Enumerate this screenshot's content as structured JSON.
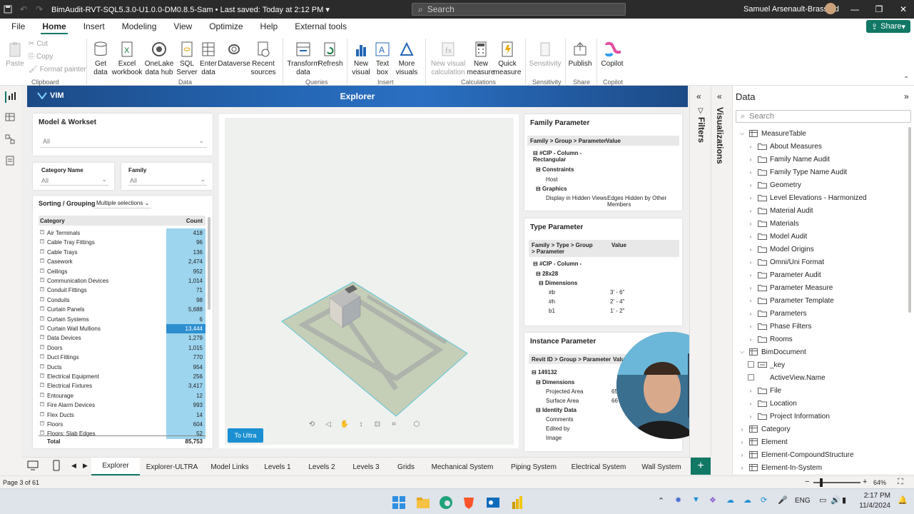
{
  "window": {
    "title": "BimAudit-RVT-SQL5.3.0-U1.0.0-DM0.8.5-Sam",
    "saved": "Last saved: Today at 2:12 PM",
    "search_placeholder": "Search",
    "user": "Samuel Arsenault-Brassard"
  },
  "menu": [
    "File",
    "Home",
    "Insert",
    "Modeling",
    "View",
    "Optimize",
    "Help",
    "External tools"
  ],
  "menu_active": "Home",
  "share_label": "Share",
  "ribbon": {
    "clipboard": {
      "paste": "Paste",
      "cut": "Cut",
      "copy": "Copy",
      "format_painter": "Format painter",
      "label": "Clipboard"
    },
    "data": {
      "get_data": "Get data",
      "excel": "Excel workbook",
      "onelake": "OneLake data hub",
      "sql": "SQL Server",
      "enter": "Enter data",
      "dataverse": "Dataverse",
      "recent": "Recent sources",
      "label": "Data"
    },
    "queries": {
      "transform": "Transform data",
      "refresh": "Refresh",
      "label": "Queries"
    },
    "insert": {
      "new_visual": "New visual",
      "text_box": "Text box",
      "more_visuals": "More visuals",
      "label": "Insert"
    },
    "calculations": {
      "new_visual_calc": "New visual calculation",
      "new_measure": "New measure",
      "quick_measure": "Quick measure",
      "label": "Calculations"
    },
    "sensitivity": {
      "btn": "Sensitivity",
      "label": "Sensitivity"
    },
    "share": {
      "publish": "Publish",
      "label": "Share"
    },
    "copilot": {
      "btn": "Copilot",
      "label": "Copilot"
    }
  },
  "report": {
    "logo": "VIM",
    "title": "Explorer",
    "model_workset": {
      "title": "Model & Workset",
      "value": "All"
    },
    "category_name": {
      "title": "Category Name",
      "value": "All"
    },
    "family": {
      "title": "Family",
      "value": "All"
    },
    "sorting": {
      "title": "Sorting / Grouping",
      "value": "Multiple selections"
    },
    "category_table": {
      "col_category": "Category",
      "col_count": "Count",
      "rows": [
        {
          "name": "Air Terminals",
          "count": "418"
        },
        {
          "name": "Cable Tray Fittings",
          "count": "96"
        },
        {
          "name": "Cable Trays",
          "count": "136"
        },
        {
          "name": "Casework",
          "count": "2,474"
        },
        {
          "name": "Ceilings",
          "count": "952"
        },
        {
          "name": "Communication Devices",
          "count": "1,014"
        },
        {
          "name": "Conduit Fittings",
          "count": "71"
        },
        {
          "name": "Conduits",
          "count": "98"
        },
        {
          "name": "Curtain Panels",
          "count": "5,688"
        },
        {
          "name": "Curtain Systems",
          "count": "6"
        },
        {
          "name": "Curtain Wall Mullions",
          "count": "13,444"
        },
        {
          "name": "Data Devices",
          "count": "1,279"
        },
        {
          "name": "Doors",
          "count": "1,015"
        },
        {
          "name": "Duct Fittings",
          "count": "770"
        },
        {
          "name": "Ducts",
          "count": "954"
        },
        {
          "name": "Electrical Equipment",
          "count": "256"
        },
        {
          "name": "Electrical Fixtures",
          "count": "3,417"
        },
        {
          "name": "Entourage",
          "count": "12"
        },
        {
          "name": "Fire Alarm Devices",
          "count": "993"
        },
        {
          "name": "Flex Ducts",
          "count": "14"
        },
        {
          "name": "Floors",
          "count": "604"
        },
        {
          "name": "Floors: Slab Edges",
          "count": "52"
        }
      ],
      "total_label": "Total",
      "total_value": "85,753",
      "highlight_index": 10
    },
    "to_ultra": "To Ultra",
    "family_param": {
      "title": "Family Parameter",
      "col1": "Family > Group > Parameter",
      "col2": "Value",
      "r1": "#CIP - Column - Rectangular",
      "r2": "Constraints",
      "r3": "Host",
      "r4": "Graphics",
      "r5": "Display in Hidden Views",
      "r5v": "Edges Hidden by Other Members"
    },
    "type_param": {
      "title": "Type Parameter",
      "col1": "Family > Type > Group > Parameter",
      "col2": "Value",
      "r1": "#CIP - Column -",
      "r2": "28x28",
      "r3": "Dimensions",
      "rows": [
        {
          "k": "#b",
          "v": "3' - 6\""
        },
        {
          "k": "#h",
          "v": "2' - 4\""
        },
        {
          "k": "b1",
          "v": "1' - 2\""
        }
      ]
    },
    "instance_param": {
      "title": "Instance Parameter",
      "col1": "Revit ID > Group > Parameter",
      "col2": "Valu",
      "r1": "149132",
      "r2": "Dimensions",
      "r3": "Projected Area",
      "r3v": "65",
      "r4": "Surface Area",
      "r4v": "66",
      "r5": "Identity Data",
      "r6": "Comments",
      "r7": "Edited by",
      "r8": "Image"
    }
  },
  "panes": {
    "filters": "Filters",
    "visualizations": "Visualizations"
  },
  "data_pane": {
    "title": "Data",
    "search": "Search",
    "tree": [
      {
        "label": "MeasureTable",
        "level": 0,
        "type": "table",
        "open": true
      },
      {
        "label": "About Measures",
        "level": 1,
        "type": "folder"
      },
      {
        "label": "Family Name Audit",
        "level": 1,
        "type": "folder"
      },
      {
        "label": "Family Type Name Audit",
        "level": 1,
        "type": "folder"
      },
      {
        "label": "Geometry",
        "level": 1,
        "type": "folder"
      },
      {
        "label": "Level Elevations - Harmonized",
        "level": 1,
        "type": "folder"
      },
      {
        "label": "Material Audit",
        "level": 1,
        "type": "folder"
      },
      {
        "label": "Materials",
        "level": 1,
        "type": "folder"
      },
      {
        "label": "Model Audit",
        "level": 1,
        "type": "folder"
      },
      {
        "label": "Model Origins",
        "level": 1,
        "type": "folder"
      },
      {
        "label": "Omni/Uni Format",
        "level": 1,
        "type": "folder"
      },
      {
        "label": "Parameter Audit",
        "level": 1,
        "type": "folder"
      },
      {
        "label": "Parameter Measure",
        "level": 1,
        "type": "folder"
      },
      {
        "label": "Parameter Template",
        "level": 1,
        "type": "folder"
      },
      {
        "label": "Parameters",
        "level": 1,
        "type": "folder"
      },
      {
        "label": "Phase Filters",
        "level": 1,
        "type": "folder"
      },
      {
        "label": "Rooms",
        "level": 1,
        "type": "folder"
      },
      {
        "label": "BimDocument",
        "level": 0,
        "type": "table",
        "open": true
      },
      {
        "label": "_key",
        "level": 1,
        "type": "keyfield"
      },
      {
        "label": "ActiveView.Name",
        "level": 1,
        "type": "field"
      },
      {
        "label": "File",
        "level": 1,
        "type": "folder"
      },
      {
        "label": "Location",
        "level": 1,
        "type": "folder"
      },
      {
        "label": "Project Information",
        "level": 1,
        "type": "folder"
      },
      {
        "label": "Category",
        "level": 0,
        "type": "table"
      },
      {
        "label": "Element",
        "level": 0,
        "type": "table"
      },
      {
        "label": "Element-CompoundStructure",
        "level": 0,
        "type": "table"
      },
      {
        "label": "Element-In-System",
        "level": 0,
        "type": "table"
      }
    ]
  },
  "page_tabs": [
    "Explorer",
    "Explorer-ULTRA",
    "Model Links",
    "Levels 1",
    "Levels 2",
    "Levels 3",
    "Grids",
    "Mechanical System",
    "Piping System",
    "Electrical System",
    "Wall System"
  ],
  "active_tab": "Explorer",
  "status": {
    "page": "Page 3 of 61",
    "zoom": "64%"
  },
  "taskbar": {
    "lang": "ENG",
    "time": "2:17 PM",
    "date": "11/4/2024"
  },
  "colors": {
    "accent": "#117865",
    "bar": "#9dd4ee",
    "bar_highlight": "#2d8fd0",
    "header_blue": "#2567b5"
  }
}
